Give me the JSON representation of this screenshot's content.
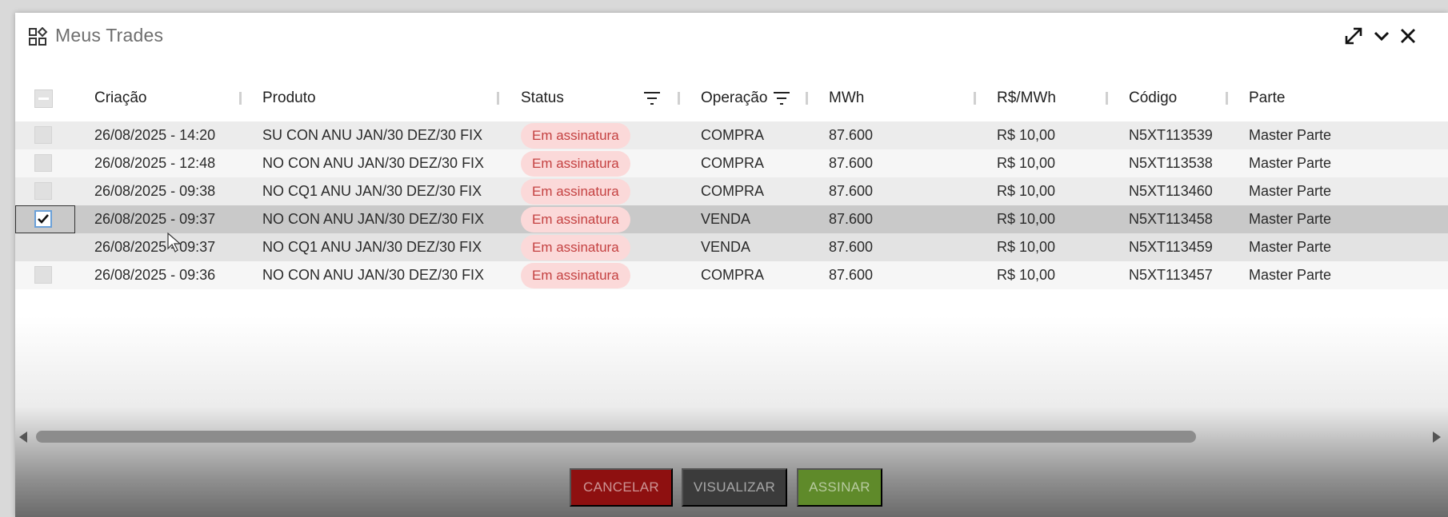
{
  "window": {
    "title": "Meus Trades",
    "icons": [
      "widgets-icon",
      "expand-icon",
      "chevron-down-icon",
      "close-icon"
    ]
  },
  "table": {
    "columns": [
      "Criação",
      "Produto",
      "Status",
      "Operação",
      "MWh",
      "R$/MWh",
      "Código",
      "Parte"
    ],
    "rows": [
      {
        "criacao": "26/08/2025 - 14:20",
        "produto": "SU CON ANU JAN/30 DEZ/30 FIX",
        "status": "Em assinatura",
        "operacao": "COMPRA",
        "mwh": "87.600",
        "preco": "R$ 10,00",
        "codigo": "N5XT113539",
        "parte": "Master Parte"
      },
      {
        "criacao": "26/08/2025 - 12:48",
        "produto": "NO CON ANU JAN/30 DEZ/30 FIX",
        "status": "Em assinatura",
        "operacao": "COMPRA",
        "mwh": "87.600",
        "preco": "R$ 10,00",
        "codigo": "N5XT113538",
        "parte": "Master Parte"
      },
      {
        "criacao": "26/08/2025 - 09:38",
        "produto": "NO CQ1 ANU JAN/30 DEZ/30 FIX",
        "status": "Em assinatura",
        "operacao": "COMPRA",
        "mwh": "87.600",
        "preco": "R$ 10,00",
        "codigo": "N5XT113460",
        "parte": "Master Parte"
      },
      {
        "criacao": "26/08/2025 - 09:37",
        "produto": "NO CON ANU JAN/30 DEZ/30 FIX",
        "status": "Em assinatura",
        "operacao": "VENDA",
        "mwh": "87.600",
        "preco": "R$ 10,00",
        "codigo": "N5XT113458",
        "parte": "Master Parte"
      },
      {
        "criacao": "26/08/2025 - 09:37",
        "produto": "NO CQ1 ANU JAN/30 DEZ/30 FIX",
        "status": "Em assinatura",
        "operacao": "VENDA",
        "mwh": "87.600",
        "preco": "R$ 10,00",
        "codigo": "N5XT113459",
        "parte": "Master Parte"
      },
      {
        "criacao": "26/08/2025 - 09:36",
        "produto": "NO CON ANU JAN/30 DEZ/30 FIX",
        "status": "Em assinatura",
        "operacao": "COMPRA",
        "mwh": "87.600",
        "preco": "R$ 10,00",
        "codigo": "N5XT113457",
        "parte": "Master Parte"
      }
    ],
    "selected_row": 3
  },
  "footer": {
    "cancel_label": "CANCELAR",
    "view_label": "VISUALIZAR",
    "sign_label": "ASSINAR"
  },
  "colors": {
    "status_badge_bg": "#fbd9d9",
    "status_badge_text": "#c44141",
    "cancel": "#8e1010",
    "view": "#3b3b3b",
    "sign": "#5f8a2a"
  }
}
